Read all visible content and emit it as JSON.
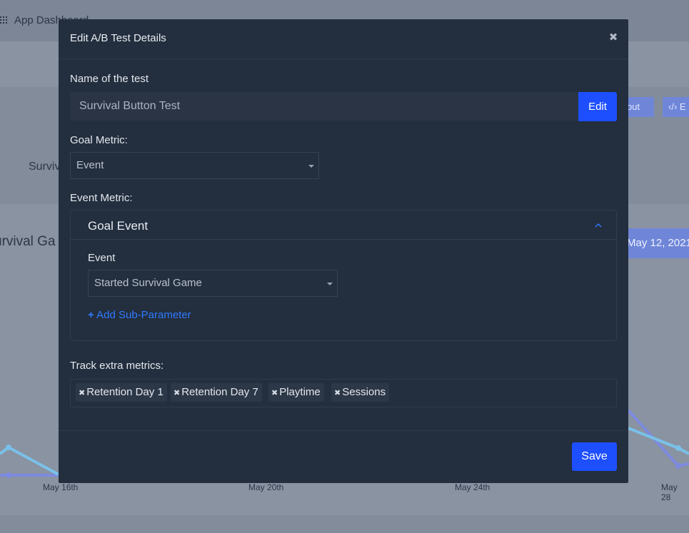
{
  "background": {
    "app_title": "App Dashboard",
    "survival_small": "Surviv",
    "survival_big": "urvival Ga",
    "btn_checkout": "out",
    "btn_embed": "‹/› E",
    "date_button": "May 12, 2021",
    "x_axis": [
      "May 16th",
      "May 20th",
      "May 24th",
      "May 28"
    ]
  },
  "modal": {
    "title": "Edit A/B Test Details",
    "name_label": "Name of the test",
    "name_value": "Survival Button Test",
    "edit_label": "Edit",
    "goal_metric_label": "Goal Metric:",
    "goal_metric_value": "Event",
    "event_metric_label": "Event Metric:",
    "goal_event": {
      "title": "Goal Event",
      "event_label": "Event",
      "event_value": "Started Survival Game",
      "add_sub_parameter": "Add Sub-Parameter"
    },
    "track_extra_label": "Track extra metrics:",
    "tags": [
      "Retention Day 1",
      "Retention Day 7",
      "Playtime",
      "Sessions"
    ],
    "save_label": "Save"
  },
  "colors": {
    "accent": "#1e4fff",
    "modal_bg": "#232e3e",
    "link": "#2f7bff"
  }
}
